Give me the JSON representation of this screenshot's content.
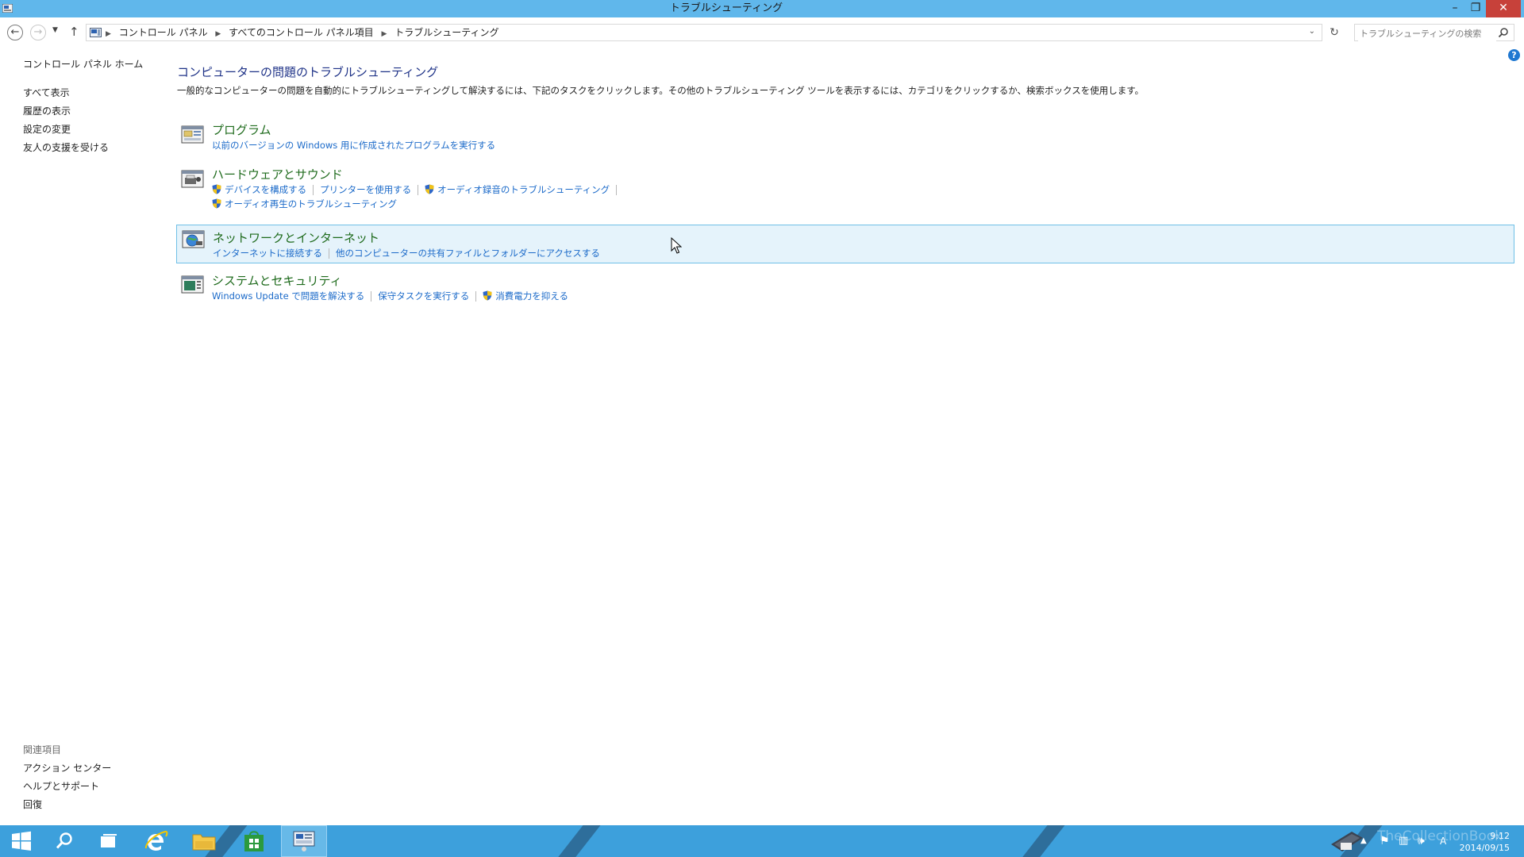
{
  "window": {
    "title": "トラブルシューティング"
  },
  "addressbar": {
    "breadcrumbs": [
      "コントロール パネル",
      "すべてのコントロール パネル項目",
      "トラブルシューティング"
    ],
    "search_placeholder": "トラブルシューティングの検索"
  },
  "leftpane": {
    "home": "コントロール パネル ホーム",
    "tasks": [
      "すべて表示",
      "履歴の表示",
      "設定の変更",
      "友人の支援を受ける"
    ],
    "related_header": "関連項目",
    "related_links": [
      "アクション センター",
      "ヘルプとサポート",
      "回復"
    ]
  },
  "main": {
    "title": "コンピューターの問題のトラブルシューティング",
    "description": "一般的なコンピューターの問題を自動的にトラブルシューティングして解決するには、下記のタスクをクリックします。その他のトラブルシューティング ツールを表示するには、カテゴリをクリックするか、検索ボックスを使用します。",
    "categories": [
      {
        "title": "プログラム",
        "icon": "programs-icon",
        "links": [
          {
            "label": "以前のバージョンの Windows 用に作成されたプログラムを実行する",
            "shield": false
          }
        ]
      },
      {
        "title": "ハードウェアとサウンド",
        "icon": "hardware-sound-icon",
        "links": [
          {
            "label": "デバイスを構成する",
            "shield": true
          },
          {
            "label": "プリンターを使用する",
            "shield": false
          },
          {
            "label": "オーディオ録音のトラブルシューティング",
            "shield": true
          },
          {
            "label": "オーディオ再生のトラブルシューティング",
            "shield": true
          }
        ]
      },
      {
        "title": "ネットワークとインターネット",
        "icon": "network-internet-icon",
        "links": [
          {
            "label": "インターネットに接続する",
            "shield": false
          },
          {
            "label": "他のコンピューターの共有ファイルとフォルダーにアクセスする",
            "shield": false
          }
        ]
      },
      {
        "title": "システムとセキュリティ",
        "icon": "system-security-icon",
        "links": [
          {
            "label": "Windows Update で問題を解決する",
            "shield": false
          },
          {
            "label": "保守タスクを実行する",
            "shield": false
          },
          {
            "label": "消費電力を抑える",
            "shield": true
          }
        ]
      }
    ]
  },
  "taskbar": {
    "clock_time": "9:12",
    "clock_date": "2014/09/15",
    "ime": "A",
    "watermark": "TheCollectionBook"
  },
  "colors": {
    "titlebar": "#60b7eb",
    "taskbar": "#3da0dc",
    "category_title": "#1f6b1d",
    "link": "#1b6ac9",
    "page_title": "#1e3287",
    "hover_bg": "#e5f3fb",
    "close_button": "#c7413a"
  }
}
